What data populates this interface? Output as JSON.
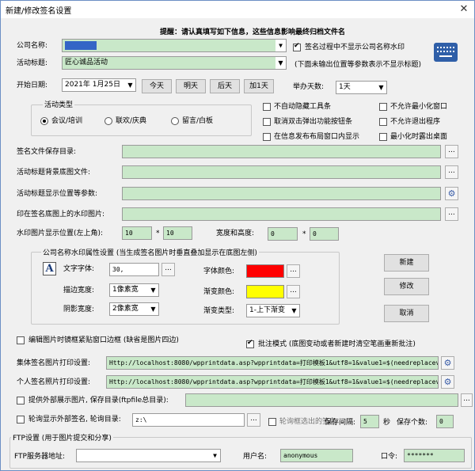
{
  "window": {
    "title": "新建/修改签名设置",
    "close_glyph": "✕"
  },
  "notice": "提醒：请认真填写如下信息，这些信息影响最终归档文件名",
  "company": {
    "label": "公司名称:",
    "value": "",
    "hide_wm_label": "签名过程中不显示公司名称水印",
    "hide_wm_checked": true
  },
  "activity_title": {
    "label": "活动标题:",
    "value": "匠心诚品活动",
    "hint": "(下面未输出位置等参数表示不显示标题)"
  },
  "start_date": {
    "label": "开始日期:",
    "value": "2021年 1月25日",
    "btn_today": "今天",
    "btn_tomorrow": "明天",
    "btn_day_after": "后天",
    "btn_plus1": "加1天"
  },
  "duration": {
    "label": "举办天数:",
    "value": "1天"
  },
  "activity_type": {
    "title": "活动类型",
    "options": [
      {
        "label": "会议/培训",
        "selected": true
      },
      {
        "label": "联欢/庆典",
        "selected": false
      },
      {
        "label": "留言/白板",
        "selected": false
      }
    ]
  },
  "options_left": [
    {
      "label": "不自动隐藏工具条",
      "checked": false
    },
    {
      "label": "取消双击弹出功能按钮条",
      "checked": false
    },
    {
      "label": "在信息发布布局窗口内显示",
      "checked": false
    }
  ],
  "options_right": [
    {
      "label": "不允许最小化窗口",
      "checked": false
    },
    {
      "label": "不允许退出程序",
      "checked": false
    },
    {
      "label": "最小化时露出桌面",
      "checked": false
    }
  ],
  "paths": {
    "save_dir": "签名文件保存目录:",
    "bg_file": "活动标题背景底图文件:",
    "title_params": "活动标题显示位置等参数:",
    "wm_image": "印在签名底图上的水印图片:"
  },
  "wm_pos": {
    "label": "水印图片显示位置(左上角):",
    "x": "10",
    "star": "*",
    "y": "10",
    "size_label": "宽度和高度:",
    "w": "0",
    "h": "0"
  },
  "wm_props": {
    "title": "公司名称水印属性设置 (当生成签名图片时垂直叠加显示在底图左侧)",
    "font_icon": "A",
    "font_label": "文字字体:",
    "font_value": "30,",
    "font_color_label": "字体颜色:",
    "font_color": "#ff0000",
    "stroke_label": "描边宽度:",
    "stroke_value": "1像素宽",
    "grad_color_label": "渐变颜色:",
    "grad_color": "#ffff00",
    "shadow_label": "阴影宽度:",
    "shadow_value": "2像素宽",
    "grad_type_label": "渐变类型:",
    "grad_type_value": "1-上下渐变"
  },
  "buttons": {
    "new": "新建",
    "edit": "修改",
    "cancel": "取消"
  },
  "frame_opt": {
    "label": "编辑图片时镜框紧贴窗口边框 (缺省是图片四边)",
    "checked": false
  },
  "batch_opt": {
    "label": "批注模式 (底图变动或者新建时清空笔画重新批注)",
    "checked": true
  },
  "print": {
    "group_label": "集体签名图片打印设置:",
    "group_value": "Http://localhost:8080/wpprintdata.asp?wpprintdata=打印模板1&utf8=1&value1=$(needreplacevalu",
    "personal_label": "个人签名照片打印设置:",
    "personal_value": "Http://localhost:8080/wpprintdata.asp?wpprintdata=打印模板1&utf8=1&value1=$(needreplacevalu"
  },
  "external": {
    "label": "提供外部展示图片, 保存目录(ftpfile总目录):",
    "checked": false
  },
  "rotation": {
    "label": "轮询显示外部签名, 轮询目录:",
    "checked": false,
    "dir": "z:\\",
    "filter_label": "轮询框选出的签名",
    "filter_checked": false,
    "interval_label": "保存间隔:",
    "interval": "5",
    "sec": "秒",
    "keep_label": "保存个数:",
    "keep": "0"
  },
  "ftp": {
    "title": "FTP设置 (用于图片提交和分享)",
    "server_label": "FTP服务器地址:",
    "server_value": "",
    "user_label": "用户名:",
    "user_value": "anonymous",
    "pwd_label": "口令:",
    "pwd_value": "*******"
  }
}
